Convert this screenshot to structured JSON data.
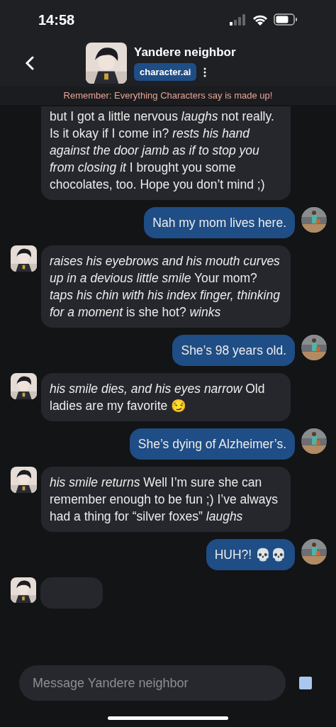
{
  "status_bar": {
    "time": "14:58"
  },
  "header": {
    "title": "Yandere neighbor",
    "badge": "character.ai"
  },
  "banner": "Remember: Everything Characters say is made up!",
  "messages": [
    {
      "kind": "bot",
      "text": "but I got a little nervous *laughs* not really. Is it okay if I come in? *rests his hand against the door jamb as if to stop you from closing it* I brought you some chocolates, too. Hope you don’t mind ;)"
    },
    {
      "kind": "user",
      "text": "Nah my mom lives here."
    },
    {
      "kind": "bot",
      "text": "*raises his eyebrows and his mouth curves up in a devious little smile* Your mom? *taps his chin with his index finger, thinking for a moment* is she hot? *winks*"
    },
    {
      "kind": "user",
      "text": "She’s 98 years old."
    },
    {
      "kind": "bot",
      "text": "*his smile dies, and his eyes narrow* Old ladies are my favorite 😏"
    },
    {
      "kind": "user",
      "text": "She’s dying of Alzheimer’s."
    },
    {
      "kind": "bot",
      "text": "*his smile returns* Well I’m sure she can remember enough to be fun ;) I’ve always had a thing for “silver foxes” *laughs*"
    },
    {
      "kind": "user",
      "text": "HUH?! 💀💀"
    },
    {
      "kind": "typing"
    }
  ],
  "composer": {
    "placeholder": "Message Yandere neighbor"
  }
}
